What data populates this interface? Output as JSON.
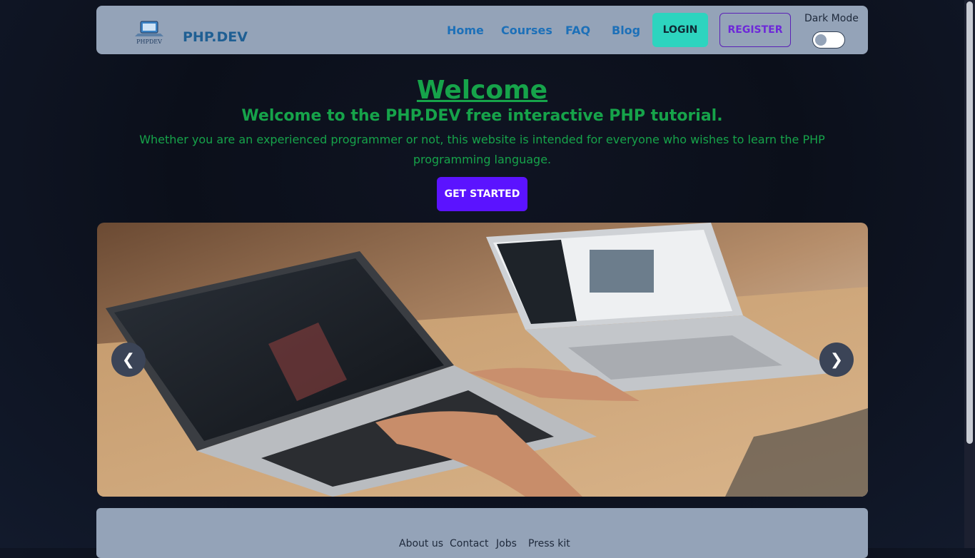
{
  "header": {
    "brand": "PHP.DEV",
    "logo_icon": "laptop-logo-icon",
    "nav": [
      {
        "label": "Home"
      },
      {
        "label": "Courses"
      },
      {
        "label": "FAQ"
      },
      {
        "label": "Blog"
      }
    ],
    "login_label": "LOGIN",
    "register_label": "REGISTER",
    "dark_mode_label": "Dark Mode"
  },
  "hero": {
    "title": "Welcome",
    "subtitle": "Welcome to the PHP.DEV free interactive PHP tutorial.",
    "description": "Whether you are an experienced programmer or not, this website is intended for everyone who wishes to learn the PHP programming language.",
    "cta_label": "GET STARTED"
  },
  "carousel": {
    "prev_label": "❮",
    "next_label": "❯"
  },
  "footer": {
    "links": [
      "About us",
      "Contact",
      "Jobs",
      "Press kit"
    ]
  },
  "colors": {
    "accent_green": "#16a34a",
    "navbar_bg": "#94a3b8",
    "login_bg": "#2dd4bf",
    "cta_bg": "#5b13ff"
  }
}
